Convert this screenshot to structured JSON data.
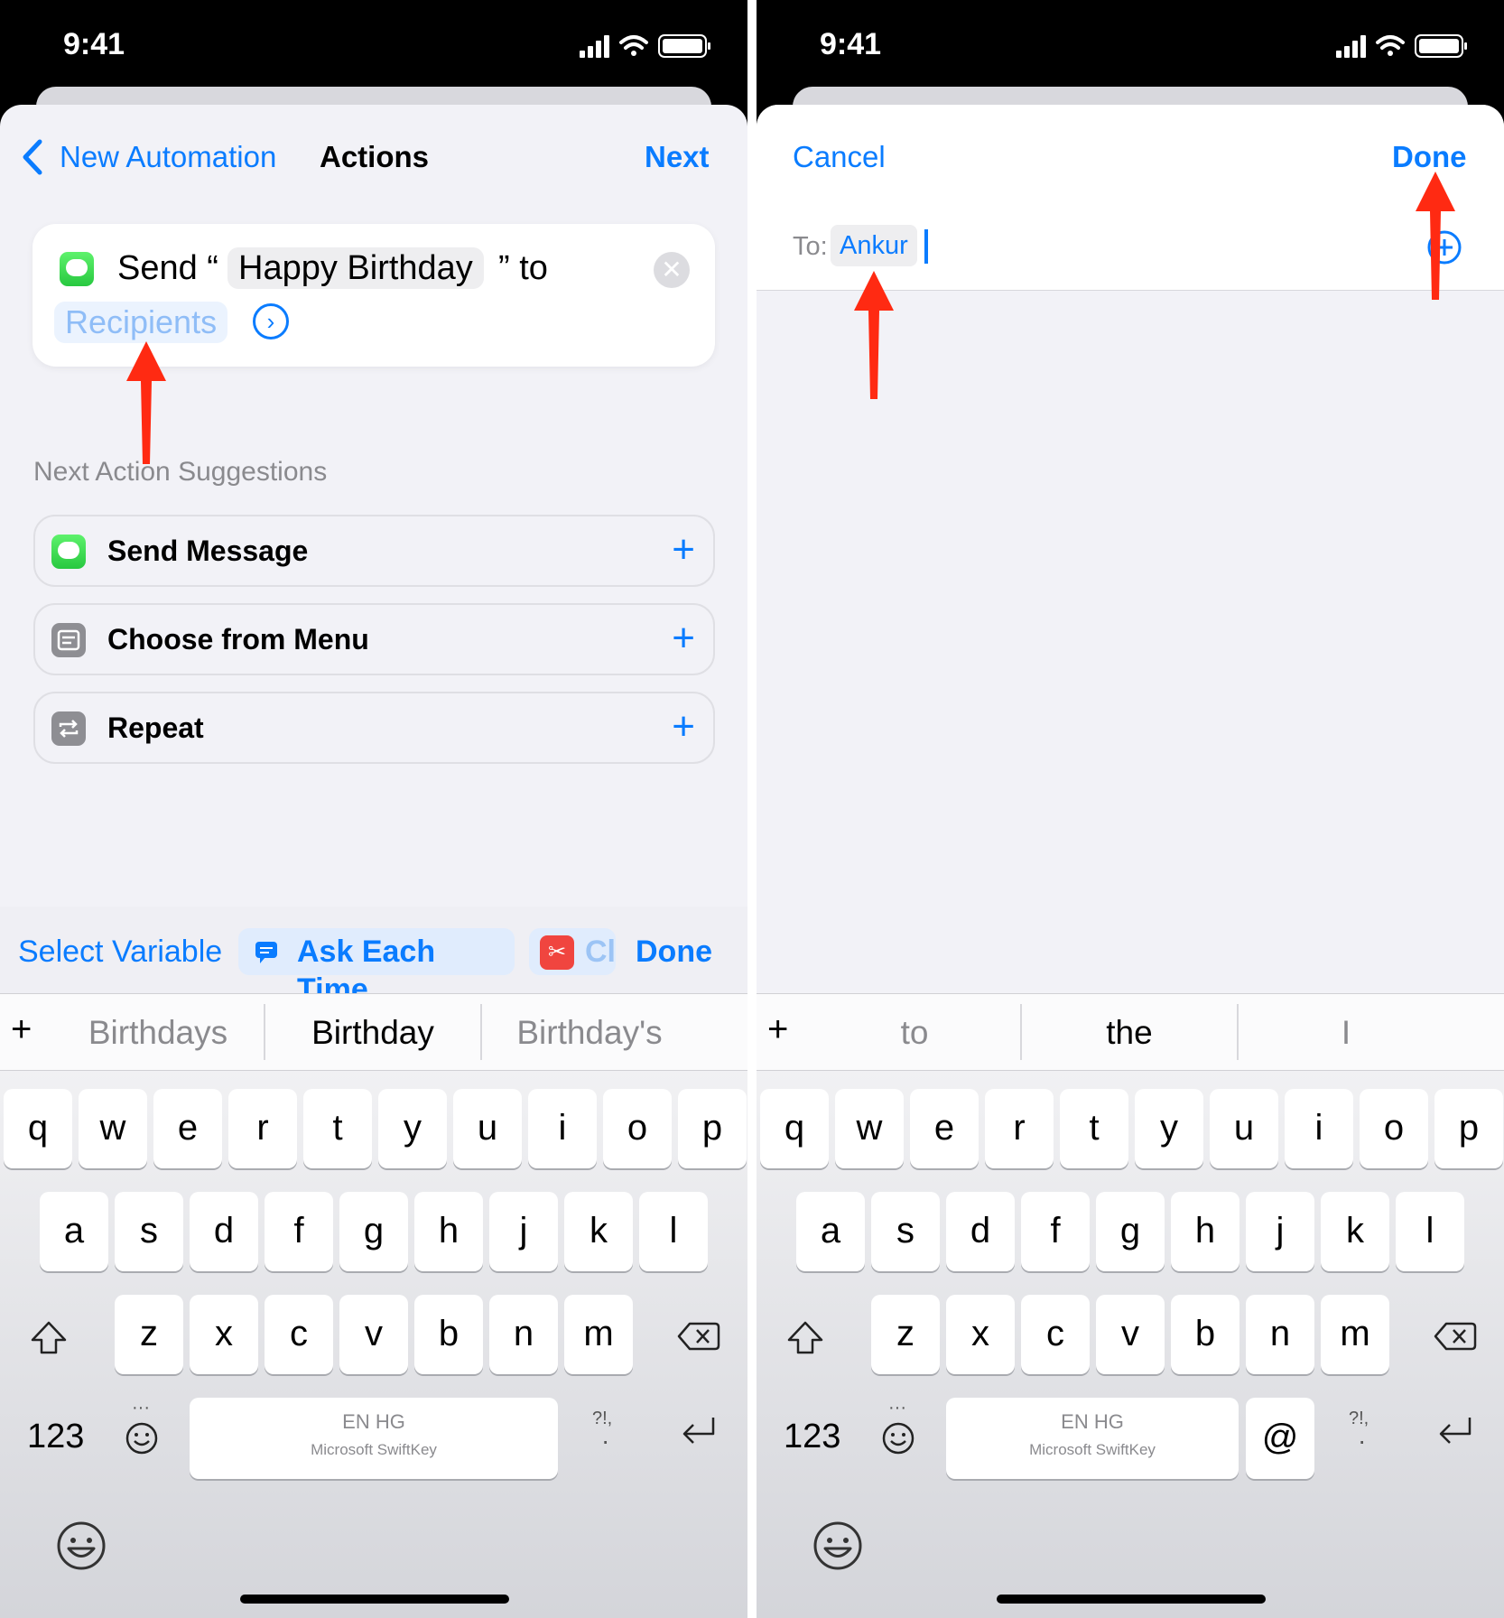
{
  "status": {
    "time": "9:41"
  },
  "left": {
    "nav": {
      "back_label": "New Automation",
      "title": "Actions",
      "next_label": "Next"
    },
    "card": {
      "send_label": "Send “",
      "message_token": "Happy Birthday",
      "to_label": "” to",
      "recipients_placeholder": "Recipients"
    },
    "suggestions_header": "Next Action Suggestions",
    "suggestions": [
      {
        "label": "Send Message",
        "icon": "messages-icon"
      },
      {
        "label": "Choose from Menu",
        "icon": "menu-icon"
      },
      {
        "label": "Repeat",
        "icon": "repeat-icon"
      }
    ],
    "variable_bar": {
      "select_variable": "Select Variable",
      "ask_each_time": "Ask Each Time",
      "clipboard_partial": "Cl",
      "done": "Done"
    },
    "predictions": [
      "Birthdays",
      "Birthday",
      "Birthday's"
    ],
    "space_lang": "EN HG",
    "space_brand": "Microsoft SwiftKey"
  },
  "right": {
    "nav": {
      "cancel_label": "Cancel",
      "done_label": "Done"
    },
    "to_label": "To:",
    "recipient": "Ankur",
    "predictions": [
      "to",
      "the",
      "I"
    ],
    "space_lang": "EN HG",
    "space_brand": "Microsoft SwiftKey",
    "at_key": "@"
  },
  "keyboard": {
    "row1": [
      "q",
      "w",
      "e",
      "r",
      "t",
      "y",
      "u",
      "i",
      "o",
      "p"
    ],
    "row2": [
      "a",
      "s",
      "d",
      "f",
      "g",
      "h",
      "j",
      "k",
      "l"
    ],
    "row3": [
      "z",
      "x",
      "c",
      "v",
      "b",
      "n",
      "m"
    ],
    "numbers_key": "123",
    "punct_key": "?!,"
  },
  "colors": {
    "accent": "#0a7cff",
    "arrow": "#ff2a12",
    "messages_green": "#34c759"
  }
}
